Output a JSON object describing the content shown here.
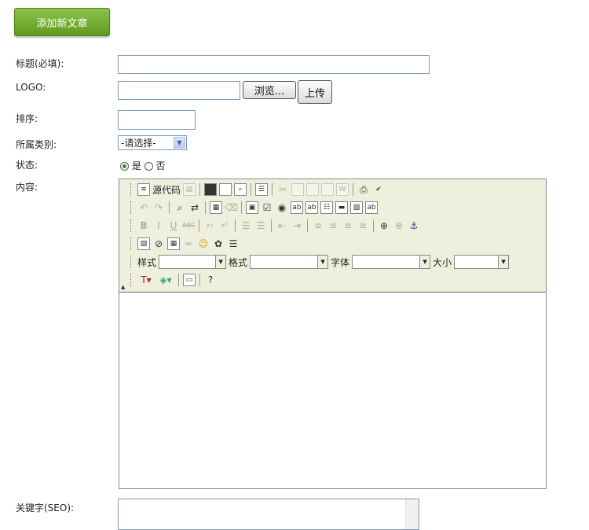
{
  "header": {
    "add_article_label": "添加新文章"
  },
  "form": {
    "title_label": "标题(必填):",
    "logo_label": "LOGO:",
    "browse_label": "浏览...",
    "upload_label": "上传",
    "order_label": "排序:",
    "category_label": "所属类别:",
    "category_selected": "-请选择-",
    "status_label": "状态:",
    "status_yes": "是",
    "status_no": "否",
    "content_label": "内容:",
    "seo_label": "关键字(SEO):"
  },
  "editor": {
    "source_label": "源代码",
    "style_label": "样式",
    "format_label": "格式",
    "font_label": "字体",
    "size_label": "大小"
  }
}
